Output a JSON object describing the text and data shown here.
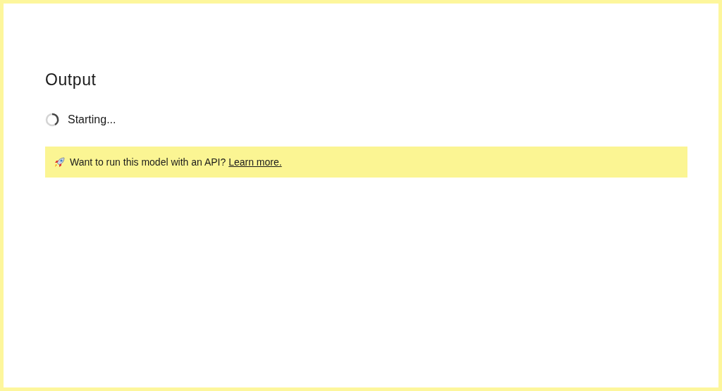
{
  "heading": "Output",
  "status": {
    "text": "Starting..."
  },
  "notice": {
    "text": "Want to run this model with an API?",
    "link": "Learn more."
  }
}
